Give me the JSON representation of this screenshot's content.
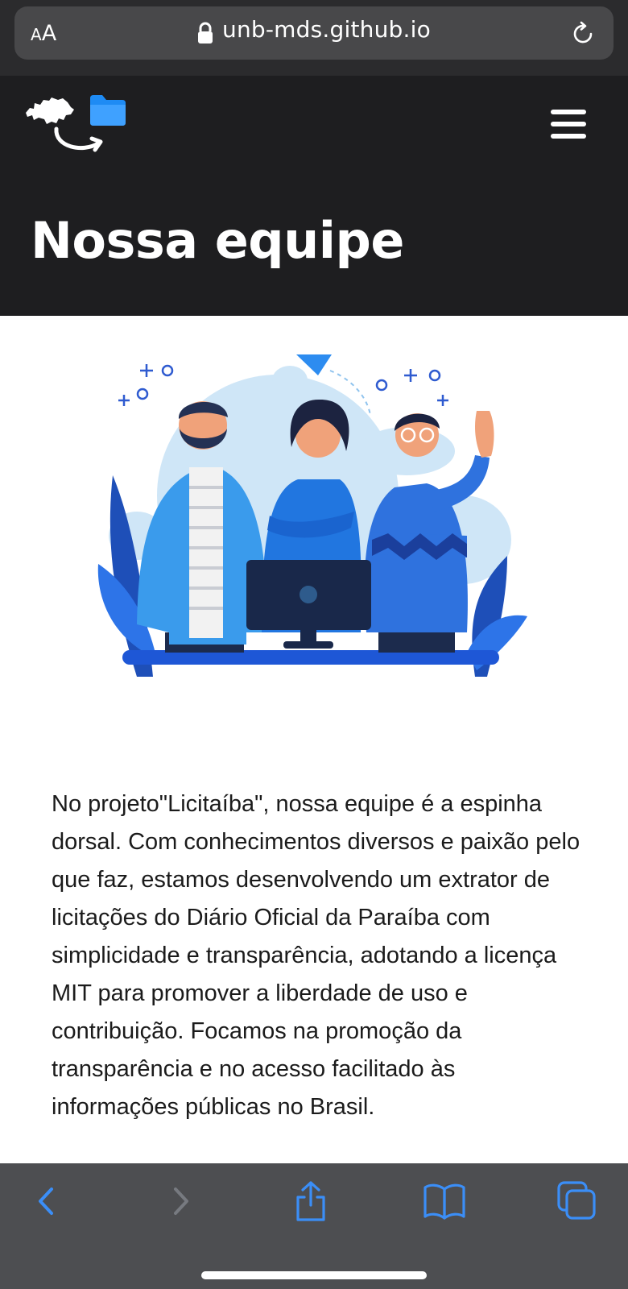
{
  "browser": {
    "text_size_small": "A",
    "text_size_large": "A",
    "url": "unb-mds.github.io"
  },
  "page": {
    "title": "Nossa equipe",
    "description": "No projeto\"Licitaíba\", nossa equipe é a espinha dorsal. Com conhecimentos diversos e paixão pelo que faz, estamos desenvolvendo um extrator de licitações do Diário Oficial da Paraíba com simplicidade e transparência, adotando a licença MIT para promover a liberdade de uso e contribuição. Focamos na promoção da transparência e no acesso facilitado às informações públicas no Brasil."
  },
  "icons": {
    "lock": "lock-icon",
    "reload": "reload-icon",
    "menu": "hamburger-menu-icon",
    "back": "chevron-left-icon",
    "forward": "chevron-right-icon",
    "share": "share-icon",
    "bookmarks": "book-icon",
    "tabs": "tabs-icon"
  },
  "colors": {
    "header_bg": "#1e1e20",
    "browser_bar": "#2b2b2d",
    "toolbar": "#4d4e51",
    "accent": "#2f7cf6"
  }
}
